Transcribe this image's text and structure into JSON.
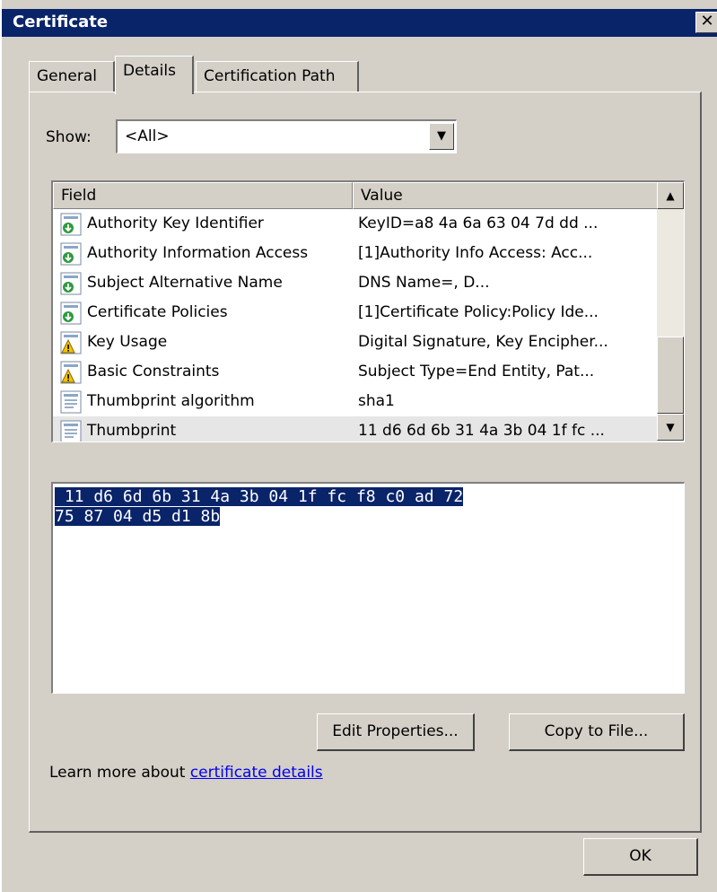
{
  "window": {
    "title": "Certificate",
    "close_symbol": "✕"
  },
  "tabs": [
    {
      "label": "General"
    },
    {
      "label": "Details",
      "active": true
    },
    {
      "label": "Certification Path"
    }
  ],
  "show": {
    "label": "Show:",
    "selected": "<All>"
  },
  "listview": {
    "columns": [
      "Field",
      "Value"
    ],
    "rows": [
      {
        "field": "Authority Key Identifier",
        "value": "KeyID=a8 4a 6a 63 04 7d dd ...",
        "icon": "extension-icon"
      },
      {
        "field": "Authority Information Access",
        "value": "[1]Authority Info Access: Acc...",
        "icon": "extension-icon"
      },
      {
        "field": "Subject Alternative Name",
        "value": "DNS Name=, D...",
        "icon": "extension-icon"
      },
      {
        "field": "Certificate Policies",
        "value": "[1]Certificate Policy:Policy Ide...",
        "icon": "extension-icon"
      },
      {
        "field": "Key Usage",
        "value": "Digital Signature, Key Encipher...",
        "icon": "critical-extension-icon"
      },
      {
        "field": "Basic Constraints",
        "value": "Subject Type=End Entity, Pat...",
        "icon": "critical-extension-icon"
      },
      {
        "field": "Thumbprint algorithm",
        "value": "sha1",
        "icon": "property-icon"
      },
      {
        "field": "Thumbprint",
        "value": "11 d6 6d 6b 31 4a 3b 04 1f fc ...",
        "icon": "property-icon",
        "selected": true
      }
    ]
  },
  "detail": {
    "line1": " 11 d6 6d 6b 31 4a 3b 04 1f fc f8 c0 ad 72",
    "line2": "75 87 04 d5 d1 8b"
  },
  "buttons": {
    "edit_properties": "Edit Properties...",
    "copy_to_file": "Copy to File...",
    "ok": "OK"
  },
  "learn_more": {
    "prefix": "Learn more about ",
    "link": "certificate details"
  },
  "colors": {
    "titlebar": "#0a246a",
    "face": "#d4d0c8",
    "selection": "#0a246a",
    "link": "#0000ee"
  }
}
